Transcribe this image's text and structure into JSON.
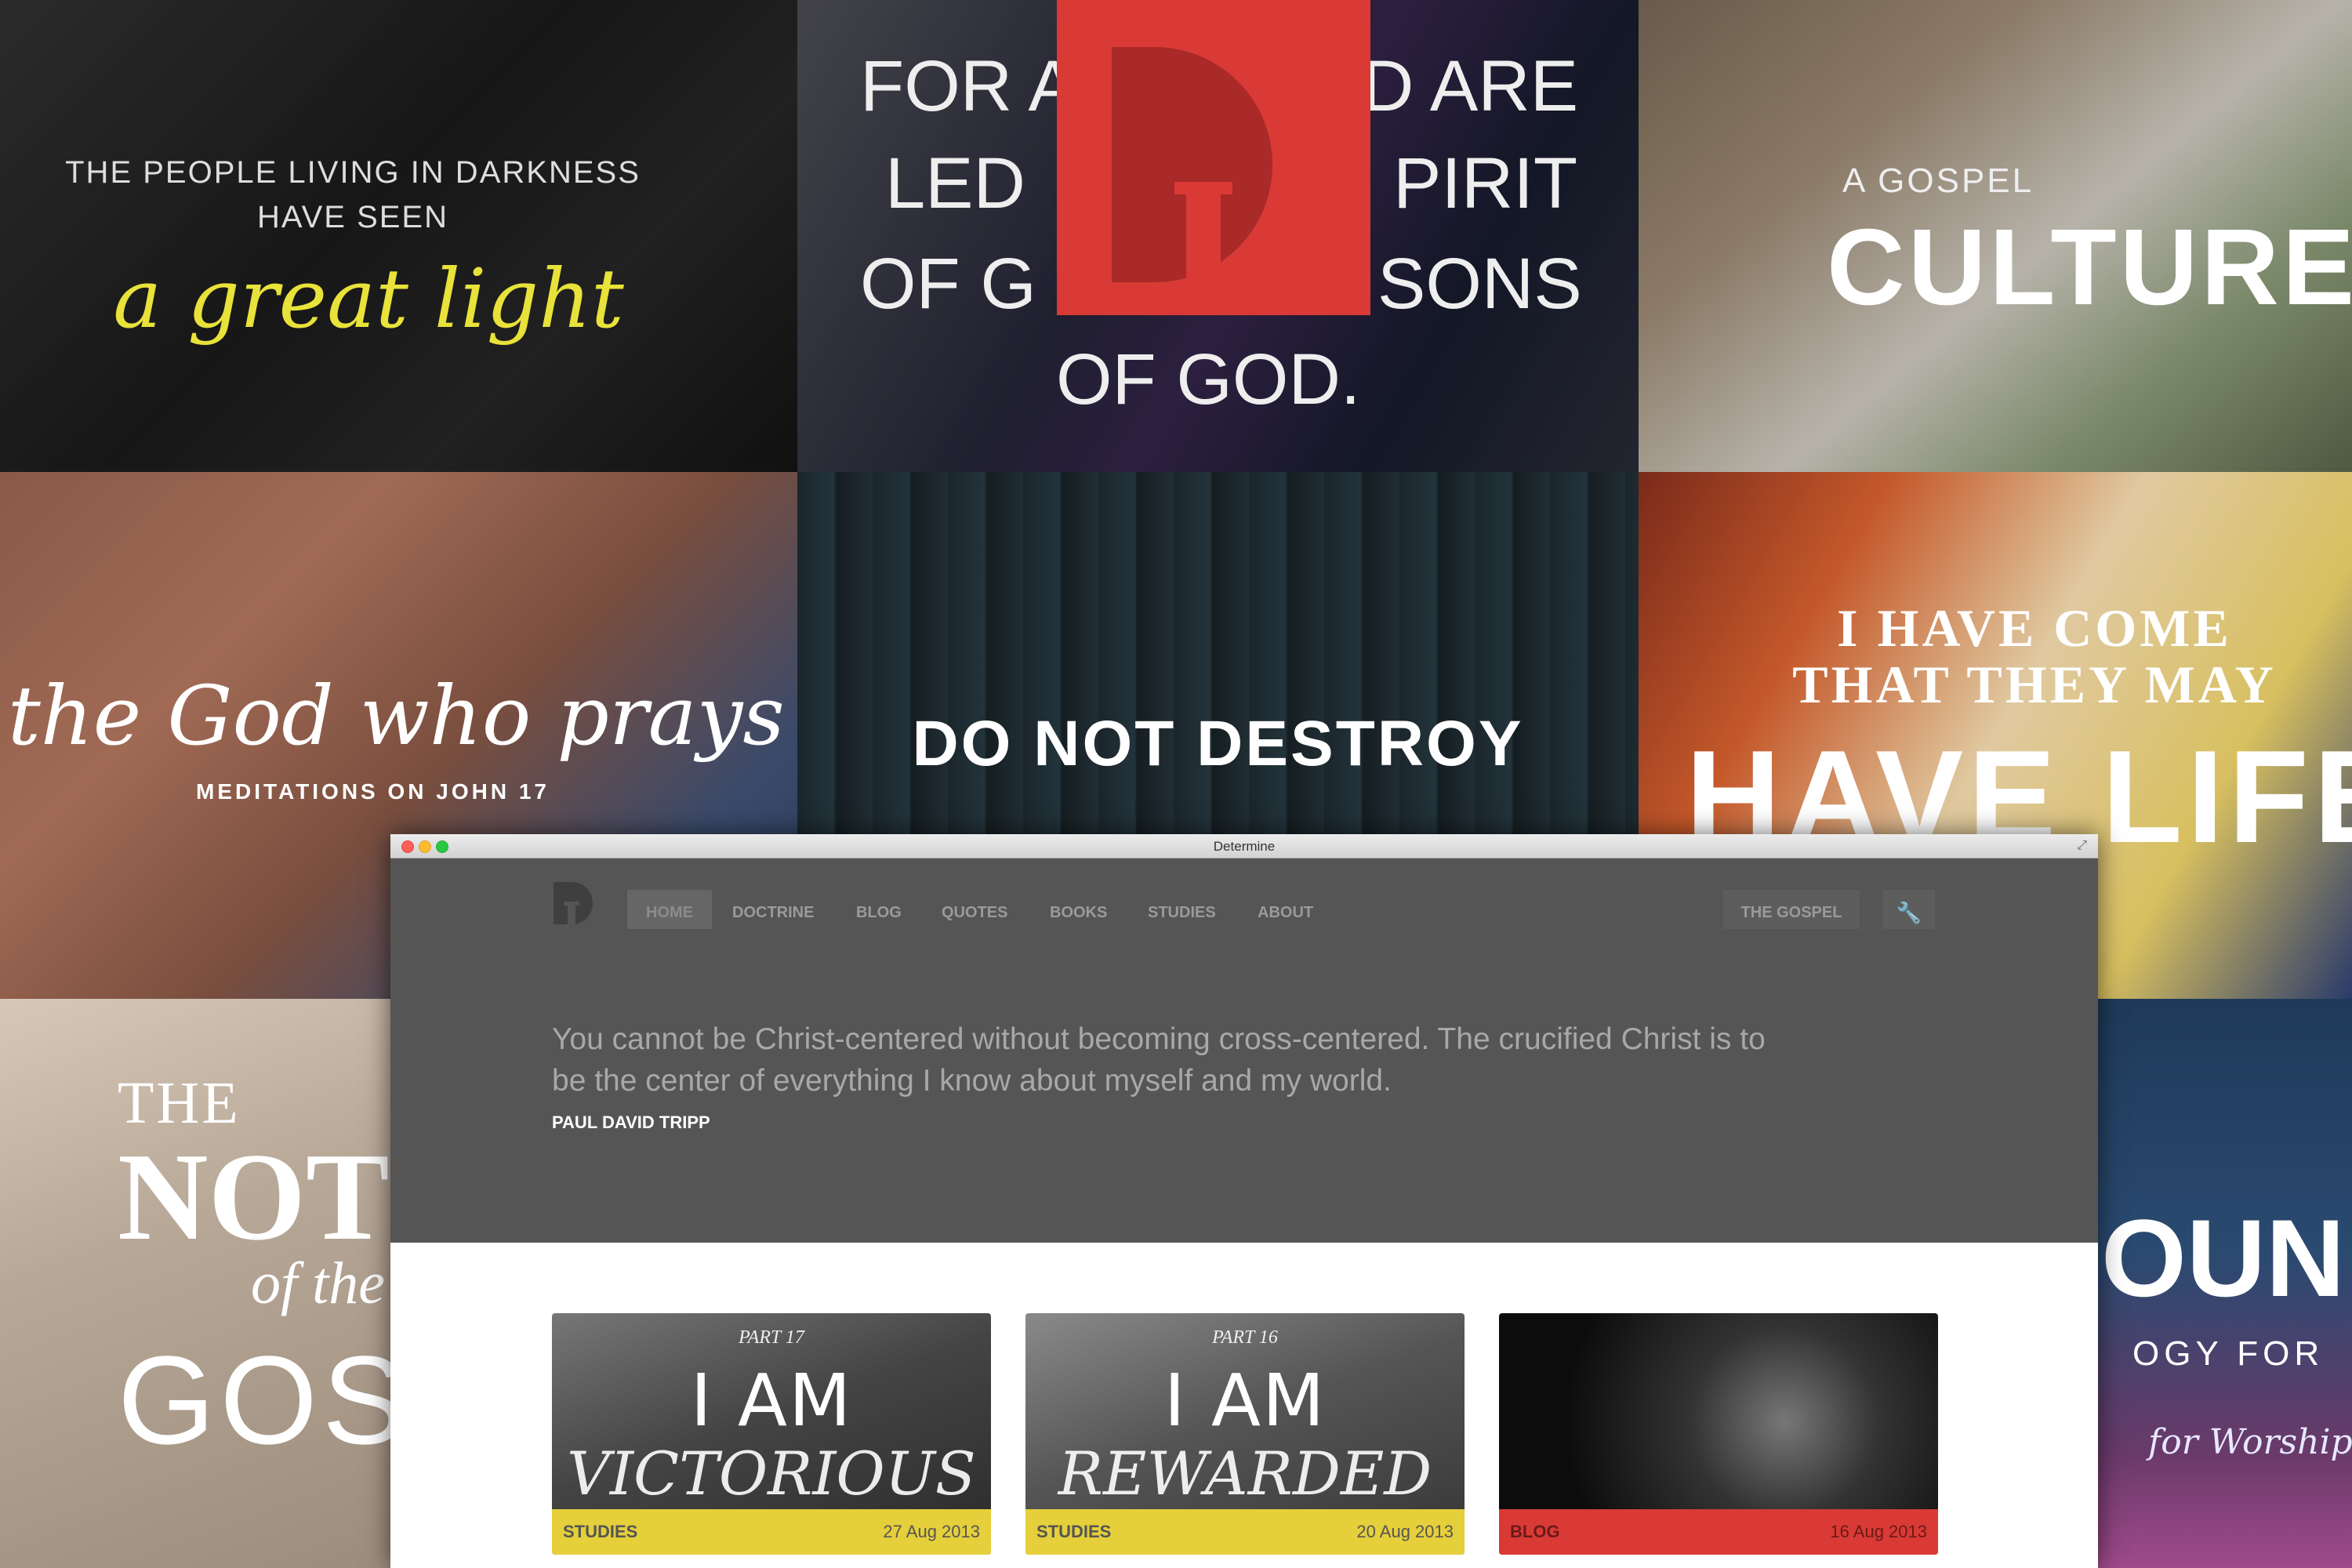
{
  "background_tiles": {
    "tile1": {
      "line1": "THE PEOPLE LIVING IN DARKNESS",
      "line2": "HAVE SEEN",
      "script": "a great light"
    },
    "tile2": {
      "line1": "FOR A",
      "line1b": "D ARE",
      "line2": "LED",
      "line2b": "PIRIT",
      "line3": "OF G",
      "line3b": "SONS",
      "line4": "OF GOD."
    },
    "tile3": {
      "small": "A GOSPEL",
      "big": "CULTURE"
    },
    "tile4": {
      "script": "the God who prays",
      "sub": "MEDITATIONS ON JOHN 17"
    },
    "tile5": {
      "big": "DO NOT DESTROY"
    },
    "tile6": {
      "line1": "I HAVE COME",
      "line2": "THAT THEY MAY",
      "big": "HAVE LIFE"
    },
    "tile7": {
      "line1": "THE",
      "big": "NOT",
      "italic": "of the",
      "bottom": "GOSP"
    },
    "tile8": {
      "big": "OUND",
      "sub": "OGY FOR",
      "script": "for Worship"
    }
  },
  "colors": {
    "logo_red": "#d93a35",
    "studies_yellow": "#e5cf3a",
    "blog_red": "#d93a35",
    "nav_bg": "#555555"
  },
  "window": {
    "title": "Determine",
    "nav": {
      "items": [
        "HOME",
        "DOCTRINE",
        "BLOG",
        "QUOTES",
        "BOOKS",
        "STUDIES",
        "ABOUT"
      ],
      "gospel": "THE GOSPEL",
      "tools_icon": "wrench-icon"
    },
    "quote": {
      "text": "You cannot be Christ-centered without becoming cross-centered. The crucified Christ is to be the center of everything I know about myself and my world.",
      "author": "PAUL DAVID TRIPP"
    },
    "cards": [
      {
        "part": "PART 17",
        "title": "I AM",
        "subtitle": "VICTORIOUS",
        "category": "STUDIES",
        "date": "27 Aug 2013"
      },
      {
        "part": "PART 16",
        "title": "I AM",
        "subtitle": "REWARDED",
        "category": "STUDIES",
        "date": "20 Aug 2013"
      },
      {
        "part": "",
        "title": "",
        "subtitle": "",
        "category": "BLOG",
        "date": "16 Aug 2013"
      }
    ]
  }
}
